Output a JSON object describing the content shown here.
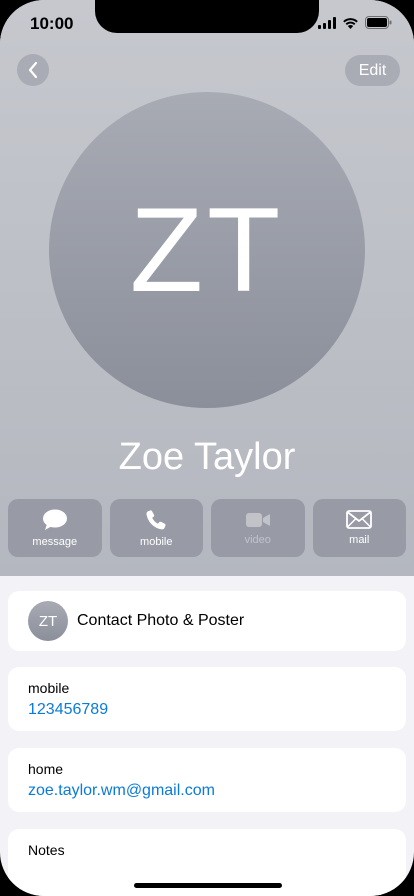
{
  "status_bar": {
    "time": "10:00"
  },
  "nav": {
    "back_icon": "chevron-left-icon",
    "edit_label": "Edit"
  },
  "contact": {
    "initials": "ZT",
    "name": "Zoe Taylor"
  },
  "actions": [
    {
      "icon": "message-bubble-icon",
      "label": "message",
      "enabled": true
    },
    {
      "icon": "phone-icon",
      "label": "mobile",
      "enabled": true
    },
    {
      "icon": "video-camera-icon",
      "label": "video",
      "enabled": false
    },
    {
      "icon": "mail-envelope-icon",
      "label": "mail",
      "enabled": true
    }
  ],
  "photo_poster": {
    "initials": "ZT",
    "label": "Contact Photo & Poster"
  },
  "fields": [
    {
      "label": "mobile",
      "value": "123456789"
    },
    {
      "label": "home",
      "value": "zoe.taylor.wm@gmail.com"
    }
  ],
  "notes": {
    "label": "Notes"
  },
  "colors": {
    "link": "#0a7bd8",
    "header_background": "#bfc1c8"
  }
}
